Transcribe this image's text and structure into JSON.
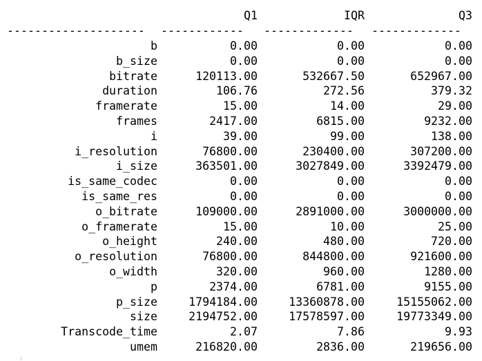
{
  "table": {
    "headers": {
      "name": "",
      "q1": "Q1",
      "iqr": "IQR",
      "q3": "Q3"
    },
    "separators": {
      "name": "--------------------",
      "q1": "------------",
      "iqr": "-------------",
      "q3": "-------------"
    },
    "rows": [
      {
        "name": "b",
        "q1": "0.00",
        "iqr": "0.00",
        "q3": "0.00"
      },
      {
        "name": "b_size",
        "q1": "0.00",
        "iqr": "0.00",
        "q3": "0.00"
      },
      {
        "name": "bitrate",
        "q1": "120113.00",
        "iqr": "532667.50",
        "q3": "652967.00"
      },
      {
        "name": "duration",
        "q1": "106.76",
        "iqr": "272.56",
        "q3": "379.32"
      },
      {
        "name": "framerate",
        "q1": "15.00",
        "iqr": "14.00",
        "q3": "29.00"
      },
      {
        "name": "frames",
        "q1": "2417.00",
        "iqr": "6815.00",
        "q3": "9232.00"
      },
      {
        "name": "i",
        "q1": "39.00",
        "iqr": "99.00",
        "q3": "138.00"
      },
      {
        "name": "i_resolution",
        "q1": "76800.00",
        "iqr": "230400.00",
        "q3": "307200.00"
      },
      {
        "name": "i_size",
        "q1": "363501.00",
        "iqr": "3027849.00",
        "q3": "3392479.00"
      },
      {
        "name": "is_same_codec",
        "q1": "0.00",
        "iqr": "0.00",
        "q3": "0.00"
      },
      {
        "name": "is_same_res",
        "q1": "0.00",
        "iqr": "0.00",
        "q3": "0.00"
      },
      {
        "name": "o_bitrate",
        "q1": "109000.00",
        "iqr": "2891000.00",
        "q3": "3000000.00"
      },
      {
        "name": "o_framerate",
        "q1": "15.00",
        "iqr": "10.00",
        "q3": "25.00"
      },
      {
        "name": "o_height",
        "q1": "240.00",
        "iqr": "480.00",
        "q3": "720.00"
      },
      {
        "name": "o_resolution",
        "q1": "76800.00",
        "iqr": "844800.00",
        "q3": "921600.00"
      },
      {
        "name": "o_width",
        "q1": "320.00",
        "iqr": "960.00",
        "q3": "1280.00"
      },
      {
        "name": "p",
        "q1": "2374.00",
        "iqr": "6781.00",
        "q3": "9155.00"
      },
      {
        "name": "p_size",
        "q1": "1794184.00",
        "iqr": "13360878.00",
        "q3": "15155062.00"
      },
      {
        "name": "size",
        "q1": "2194752.00",
        "iqr": "17578597.00",
        "q3": "19773349.00"
      },
      {
        "name": "Transcode_time",
        "q1": "2.07",
        "iqr": "7.86",
        "q3": "9.93"
      },
      {
        "name": "umem",
        "q1": "216820.00",
        "iqr": "2836.00",
        "q3": "219656.00"
      }
    ]
  }
}
